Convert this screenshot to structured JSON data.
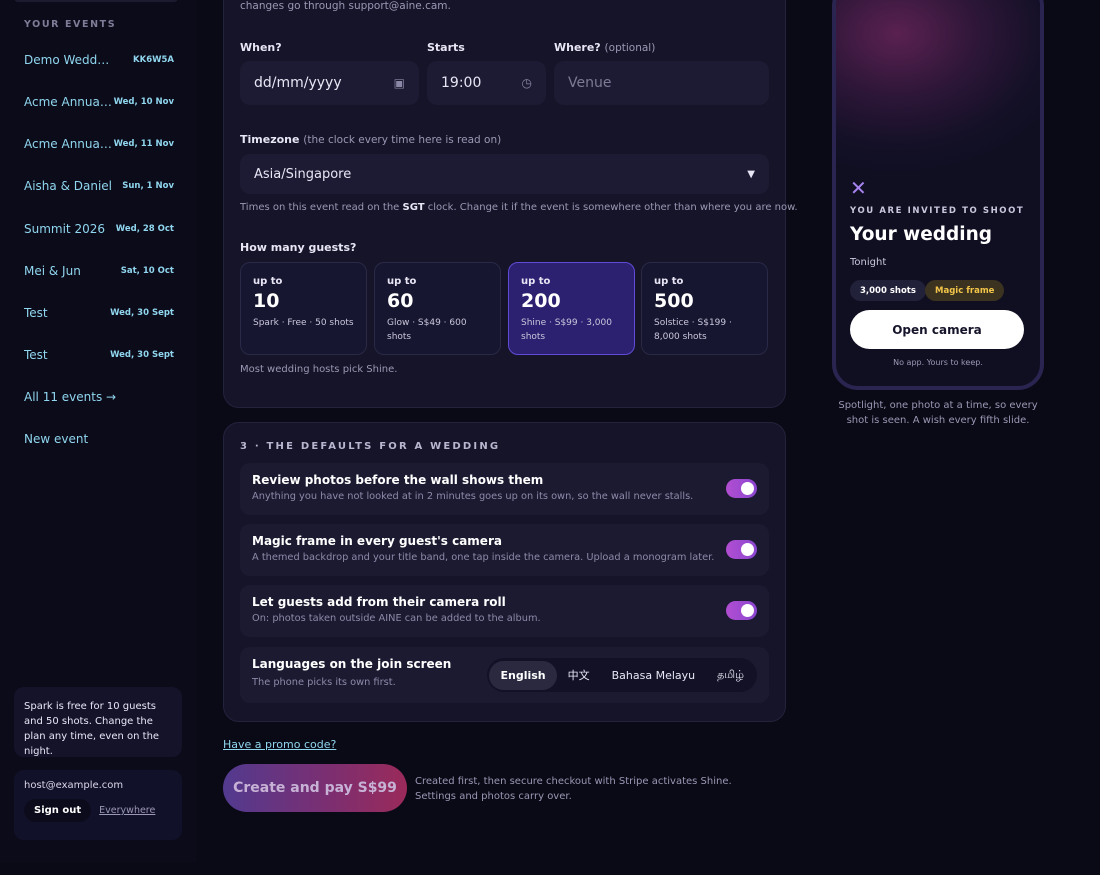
{
  "sidebar": {
    "heading": "YOUR EVENTS",
    "events": [
      {
        "name": "Demo Wedding",
        "date": "KK6W5A"
      },
      {
        "name": "Acme Annual Dinner",
        "date": "Wed, 10 Nov"
      },
      {
        "name": "Acme Annual Dinner",
        "date": "Wed, 11 Nov"
      },
      {
        "name": "Aisha & Daniel",
        "date": "Sun, 1 Nov"
      },
      {
        "name": "Summit 2026",
        "date": "Wed, 28 Oct"
      },
      {
        "name": "Mei & Jun",
        "date": "Sat, 10 Oct"
      },
      {
        "name": "Test",
        "date": "Wed, 30 Sept"
      },
      {
        "name": "Test",
        "date": "Wed, 30 Sept"
      }
    ],
    "all_events": "All 11 events →",
    "new_event": "New event",
    "note": "Spark is free for 10 guests and 50 shots. Change the plan any time, even on the night.",
    "email": "host@example.com",
    "sign_out": "Sign out",
    "everywhere": "Everywhere"
  },
  "form": {
    "top_note": "changes go through support@aine.cam.",
    "when_label": "When?",
    "when_placeholder": "dd/mm/yyyy",
    "starts_label": "Starts",
    "starts_value": "19:00",
    "where_label": "Where?",
    "where_optional": "(optional)",
    "where_placeholder": "Venue",
    "tz_label": "Timezone",
    "tz_hint": "(the clock every time here is read on)",
    "tz_value": "Asia/Singapore",
    "tz_note_a": "Times on this event read on the ",
    "tz_note_code": "SGT",
    "tz_note_b": " clock. Change it if the event is somewhere other than where you are now.",
    "guests_label": "How many guests?",
    "tiers": [
      {
        "upto": "up to",
        "num": "10",
        "desc": "Spark · Free · 50 shots",
        "selected": false
      },
      {
        "upto": "up to",
        "num": "60",
        "desc": "Glow · S$49 · 600 shots",
        "selected": false
      },
      {
        "upto": "up to",
        "num": "200",
        "desc": "Shine · S$99 · 3,000 shots",
        "selected": true
      },
      {
        "upto": "up to",
        "num": "500",
        "desc": "Solstice · S$199 · 8,000 shots",
        "selected": false
      }
    ],
    "tier_foot": "Most wedding hosts pick Shine."
  },
  "defaults": {
    "title": "3 · THE DEFAULTS FOR A WEDDING",
    "rows": [
      {
        "title": "Review photos before the wall shows them",
        "sub": "Anything you have not looked at in 2 minutes goes up on its own, so the wall never stalls."
      },
      {
        "title": "Magic frame in every guest's camera",
        "sub": "A themed backdrop and your title band, one tap inside the camera. Upload a monogram later."
      },
      {
        "title": "Let guests add from their camera roll",
        "sub": "On: photos taken outside AINE can be added to the album."
      }
    ],
    "lang_title": "Languages on the join screen",
    "lang_sub": "The phone picks its own first.",
    "languages": [
      "English",
      "中文",
      "Bahasa Melayu",
      "தமிழ்"
    ]
  },
  "actions": {
    "promo": "Have a promo code?",
    "pay": "Create and pay S$99",
    "pay_note": "Created first, then secure checkout with Stripe activates Shine. Settings and photos carry over."
  },
  "phone": {
    "invite": "YOU ARE INVITED TO SHOOT",
    "title": "Your wedding",
    "when": "Tonight",
    "chip_shots": "3,000 shots",
    "chip_magic": "Magic frame",
    "open": "Open camera",
    "noapp": "No app. Yours to keep.",
    "caption": "Spotlight, one photo at a time, so every shot is seen. A wish every fifth slide."
  }
}
